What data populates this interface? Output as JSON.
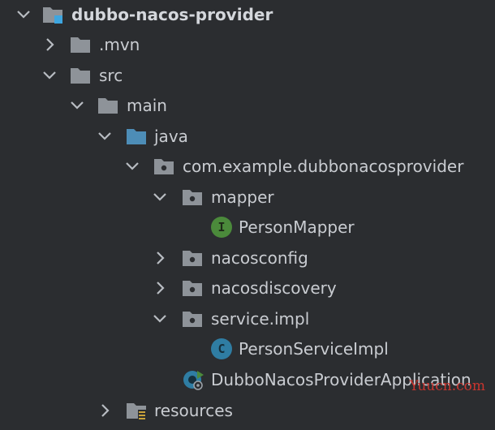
{
  "project": {
    "name": "dubbo-nacos-provider"
  },
  "tree": {
    "mvn": ".mvn",
    "src": "src",
    "main": "main",
    "java": "java",
    "package": "com.example.dubbonacosprovider",
    "mapper": "mapper",
    "person_mapper": "PersonMapper",
    "nacosconfig": "nacosconfig",
    "nacosdiscovery": "nacosdiscovery",
    "service_impl": "service.impl",
    "person_service_impl": "PersonServiceImpl",
    "application": "DubboNacosProviderApplication",
    "resources": "resources"
  },
  "badges": {
    "interface_letter": "I",
    "class_letter": "C"
  },
  "watermark": "Yuucn.com",
  "colors": {
    "background": "#2b2d30",
    "text": "#c9ccd1",
    "folder": "#8e9399",
    "source_folder": "#4d8db7",
    "interface_badge": "#4b8a3b",
    "class_badge": "#2f7da3",
    "watermark": "#c8352f"
  }
}
